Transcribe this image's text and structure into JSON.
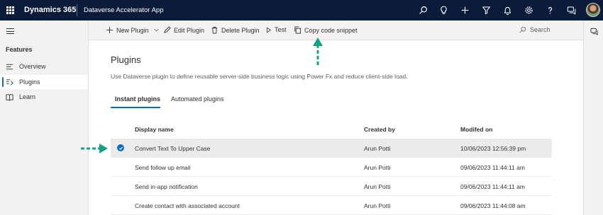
{
  "topbar": {
    "brand": "Dynamics 365",
    "app_name": "Dataverse Accelerator App",
    "icons": [
      "search-icon",
      "lightbulb-icon",
      "plus-icon",
      "filter-icon",
      "bell-icon",
      "gear-icon",
      "help-icon",
      "chat-icon",
      "avatar"
    ]
  },
  "nav": {
    "group_label": "Features",
    "items": [
      {
        "label": "Overview",
        "icon": "overview-icon",
        "active": false
      },
      {
        "label": "Plugins",
        "icon": "plugins-icon",
        "active": true
      },
      {
        "label": "Learn",
        "icon": "book-icon",
        "active": false
      }
    ]
  },
  "commands": {
    "new_plugin": "New Plugin",
    "edit_plugin": "Edit Plugin",
    "delete_plugin": "Delete Plugin",
    "test": "Test",
    "copy_snippet": "Copy code snippet",
    "search_placeholder": "Search"
  },
  "page": {
    "title": "Plugins",
    "description": "Use Dataverse plugin to define reusable server-side business logic using Power Fx and reduce client-side load.",
    "tabs": [
      "Instant plugins",
      "Automated plugins"
    ],
    "active_tab": "Instant plugins"
  },
  "table": {
    "columns": [
      "Display name",
      "Created by",
      "Modifed on"
    ],
    "rows": [
      {
        "name": "Convert Text To Upper Case",
        "created_by": "Arun Potti",
        "modified": "10/06/2023 12:56:39 pm",
        "selected": true
      },
      {
        "name": "Send follow up email",
        "created_by": "Arun Potti",
        "modified": "09/06/2023 11:44:11 am",
        "selected": false
      },
      {
        "name": "Send in-app notification",
        "created_by": "Arun Potti",
        "modified": "09/06/2023 11:44:11 am",
        "selected": false
      },
      {
        "name": "Create contact with associated account",
        "created_by": "Arun Potti",
        "modified": "09/06/2023 11:44:08 am",
        "selected": false
      }
    ]
  },
  "colors": {
    "topbar": "#0b1c3a",
    "accent": "#0f6cbd",
    "annotation_arrow": "#16a085"
  }
}
